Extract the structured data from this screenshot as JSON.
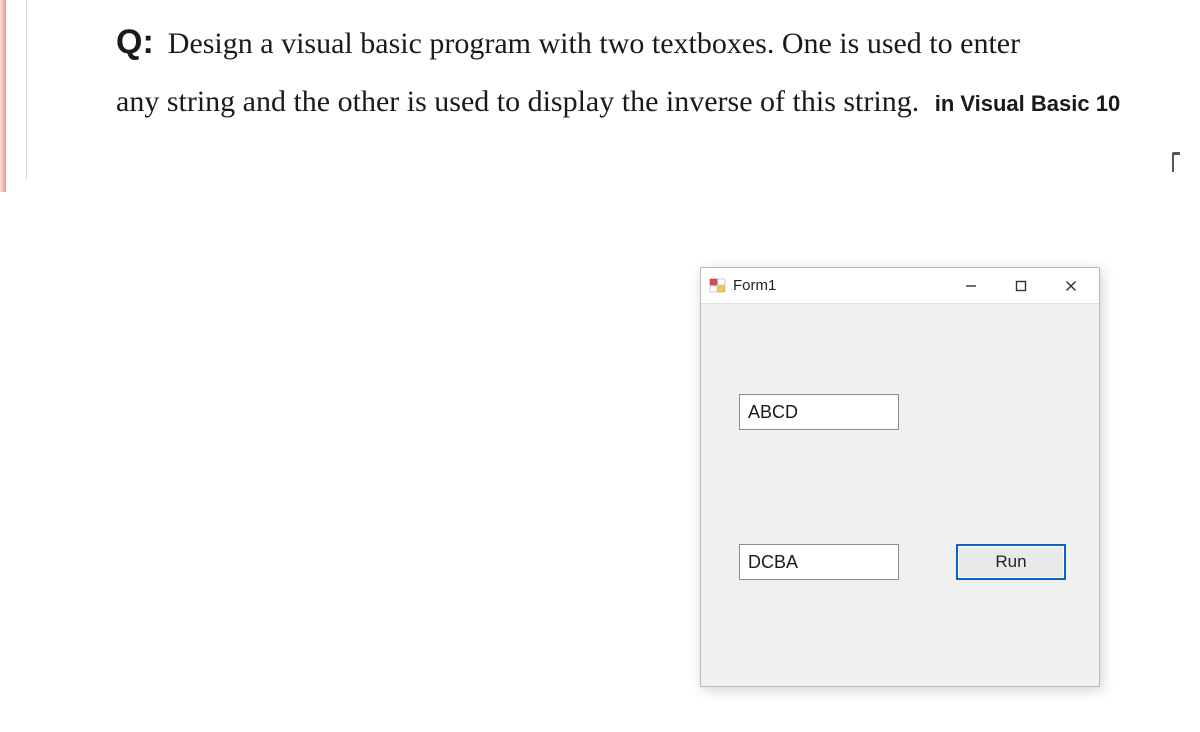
{
  "question": {
    "label": "Q:",
    "line1": "Design a visual basic program with two textboxes. One is used to enter",
    "line2_main": "any string and the other is used to display the inverse of this string.",
    "line2_note": "in Visual Basic 10"
  },
  "window": {
    "title": "Form1",
    "controls": {
      "textbox_input_value": "ABCD",
      "textbox_output_value": "DCBA",
      "run_button_label": "Run"
    }
  }
}
